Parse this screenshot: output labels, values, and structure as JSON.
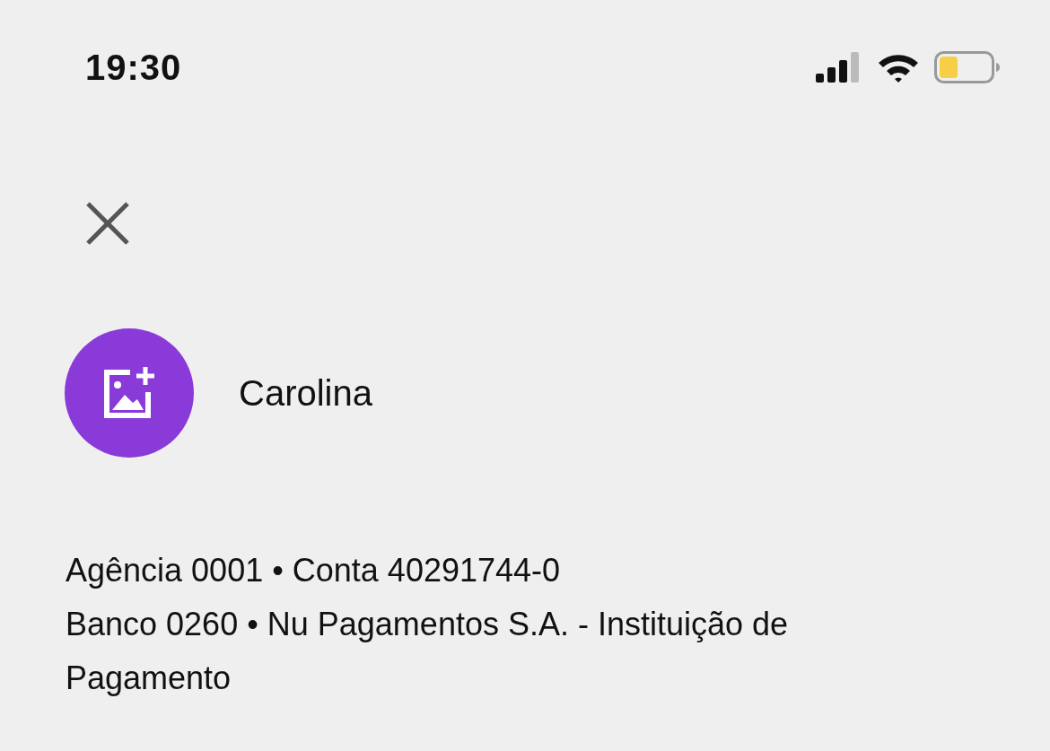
{
  "status_bar": {
    "time": "19:30"
  },
  "contact": {
    "name": "Carolina"
  },
  "account_details": [
    "Agência 0001 • Conta 40291744-0",
    "Banco 0260 • Nu Pagamentos S.A. - Instituição de Pagamento"
  ]
}
